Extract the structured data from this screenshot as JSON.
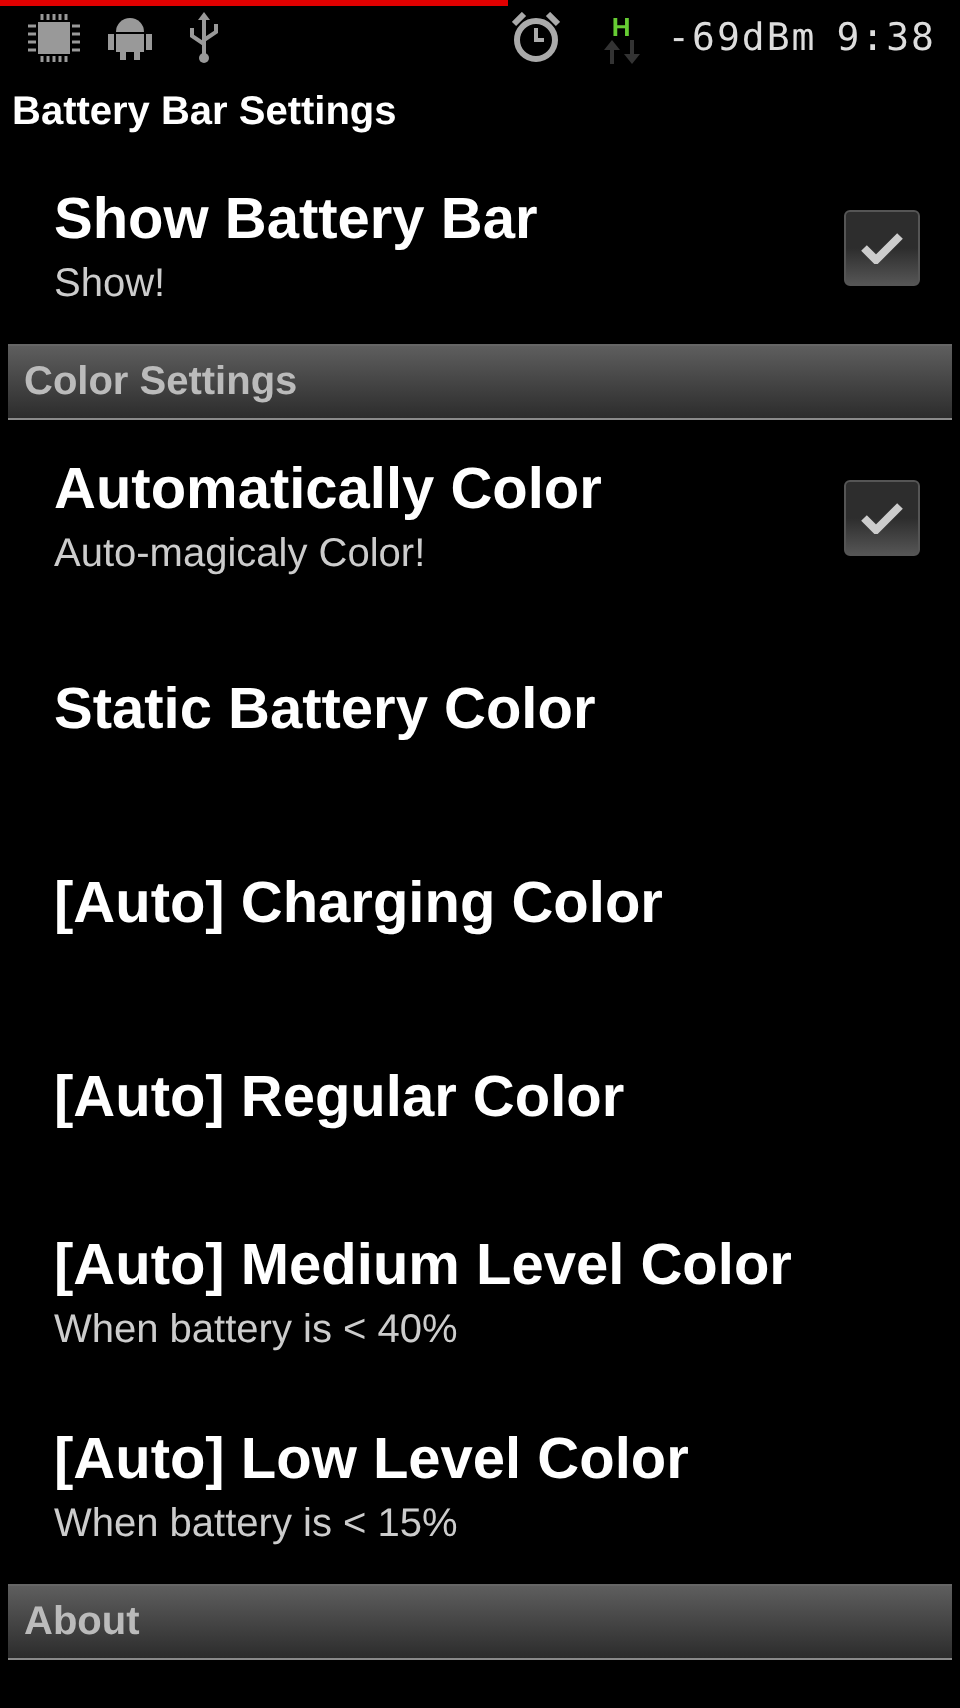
{
  "status_bar": {
    "signal": "-69dBm",
    "network": "H",
    "time": "9:38"
  },
  "title": "Battery Bar Settings",
  "items": [
    {
      "kind": "preference",
      "title": "Show Battery Bar",
      "summary": "Show!",
      "checked": true
    },
    {
      "kind": "category",
      "title": "Color Settings"
    },
    {
      "kind": "preference",
      "title": "Automatically Color",
      "summary": "Auto-magicaly Color!",
      "checked": true
    },
    {
      "kind": "preference",
      "title": "Static Battery Color"
    },
    {
      "kind": "preference",
      "title": "[Auto] Charging Color"
    },
    {
      "kind": "preference",
      "title": "[Auto] Regular Color"
    },
    {
      "kind": "preference",
      "title": "[Auto] Medium Level Color",
      "summary": "When battery is < 40%"
    },
    {
      "kind": "preference",
      "title": "[Auto] Low Level Color",
      "summary": "When battery is < 15%"
    },
    {
      "kind": "category",
      "title": "About"
    }
  ]
}
